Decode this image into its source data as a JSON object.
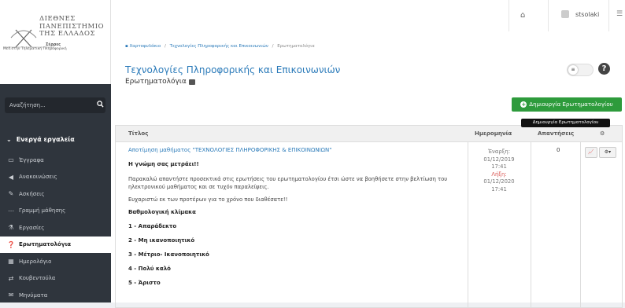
{
  "logo": {
    "line1": "ΔΙΕΘΝΕΣ",
    "line2": "ΠΑΝΕΠΙΣΤΗΜΙΟ",
    "line3": "ΤΗΣ ΕΛΛΑΔΟΣ",
    "line4": "Σέρρες",
    "line5": "Μεδ.στην Τηλεματική Πληροφορική"
  },
  "search": {
    "placeholder": "Αναζήτηση..."
  },
  "sidebar": {
    "section_title": "Ενεργά εργαλεία",
    "items": [
      {
        "label": "Έγγραφα",
        "icon": "folder-icon"
      },
      {
        "label": "Ανακοινώσεις",
        "icon": "megaphone-icon"
      },
      {
        "label": "Ασκήσεις",
        "icon": "pencil-icon"
      },
      {
        "label": "Γραμμή μάθησης",
        "icon": "dots-icon"
      },
      {
        "label": "Εργασίες",
        "icon": "flask-icon"
      },
      {
        "label": "Ερωτηματολόγια",
        "icon": "question-icon"
      },
      {
        "label": "Ημερολόγιο",
        "icon": "calendar-icon"
      },
      {
        "label": "Κουβεντούλα",
        "icon": "exchange-icon"
      },
      {
        "label": "Μηνύματα",
        "icon": "envelope-icon"
      }
    ]
  },
  "topbar": {
    "username": "stsolaki"
  },
  "breadcrumb": {
    "items": [
      "Χαρτοφυλάκιο",
      "Τεχνολογίες Πληροφορικής και Επικοινωνιών",
      "Ερωτηματολόγια"
    ],
    "separator": "/"
  },
  "page": {
    "title": "Τεχνολογίες Πληροφορικής και Επικοινωνιών",
    "subtitle": "Ερωτηματολόγια"
  },
  "actions": {
    "create_label": "Δημιουργία Ερωτηματολογίου",
    "tooltip": "Δημιουργία Ερωτηματολογίου"
  },
  "table": {
    "headers": {
      "title": "Τίτλος",
      "date": "Ημερομηνία",
      "answers": "Απαντήσεις",
      "settings": "⚙"
    },
    "row": {
      "link": "Αποτίμηση μαθήματος \"ΤΕΧΝΟΛΟΓΙΕΣ ΠΛΗΡΟΦΟΡΙΚΗΣ & ΕΠΙΚΟΙΝΩΝΙΩΝ\"",
      "heading": "Η γνώμη σας μετράει!!",
      "para1": "Παρακαλώ απαντήστε προσεκτικά στις ερωτήσεις του ερωτηματολογίου έτσι ώστε να βοηθήσετε στην βελτίωση του ηλεκτρονικού μαθήματος και σε τυχόν παραλείψεις.",
      "para2": "Ευχαριστώ εκ των προτέρων για το χρόνο που διαθέσατε!!",
      "scale_title": "Βαθμολογική κλίμακα",
      "scale": [
        "1 - Απαράδεκτο",
        "2 - Μη ικανοποιητικό",
        "3 - Μέτριο- Ικανοποιητικό",
        "4 - Πολύ καλό",
        "5 - Άριστο"
      ],
      "start_label": "Έναρξη:",
      "start_date": "01/12/2019",
      "start_time": "17:41",
      "end_label": "Λήξη:",
      "end_date": "01/12/2020",
      "end_time": "17:41",
      "answers": "0"
    }
  }
}
